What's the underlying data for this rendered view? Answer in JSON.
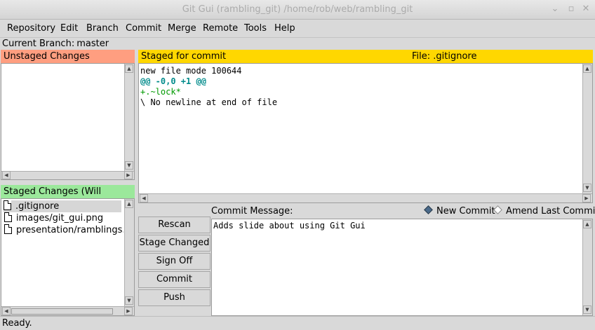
{
  "window": {
    "title": "Git Gui (rambling_git) /home/rob/web/rambling_git",
    "controls": [
      "⌄",
      "▫",
      "✕"
    ]
  },
  "menu": [
    "Repository",
    "Edit",
    "Branch",
    "Commit",
    "Merge",
    "Remote",
    "Tools",
    "Help"
  ],
  "branch": {
    "label": "Current Branch:",
    "name": "master"
  },
  "unstaged": {
    "header": "Unstaged Changes",
    "color": "#ff9e80"
  },
  "staged": {
    "header": "Staged Changes (Will Commit)",
    "color": "#9be89b",
    "files": [
      ".gitignore",
      "images/git_gui.png",
      "presentation/ramblings.odp"
    ]
  },
  "diff": {
    "header": "Staged for commit",
    "file_label": "File:",
    "file_name": ".gitignore",
    "header_color": "#ffd700",
    "lines": [
      {
        "text": "new file mode 100644",
        "color": "#000000",
        "bold": false
      },
      {
        "text": "@@ -0,0 +1 @@",
        "color": "#008b8b",
        "bold": true
      },
      {
        "text": "+.~lock*",
        "color": "#009900",
        "bold": false
      },
      {
        "text": "\\ No newline at end of file",
        "color": "#000000",
        "bold": false
      }
    ]
  },
  "commit": {
    "message_label": "Commit Message:",
    "new_commit_label": "New Commit",
    "amend_label": "Amend Last Commit",
    "message": "Adds slide about using Git Gui",
    "buttons": {
      "rescan": "Rescan",
      "stage_changed": "Stage Changed",
      "sign_off": "Sign Off",
      "commit": "Commit",
      "push": "Push"
    }
  },
  "status": "Ready."
}
